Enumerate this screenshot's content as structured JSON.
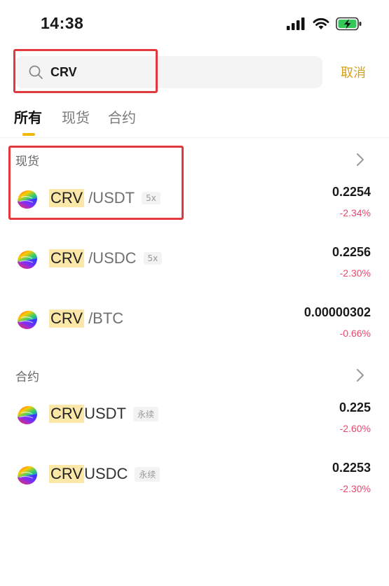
{
  "status_bar": {
    "time": "14:38"
  },
  "search": {
    "value": "CRV",
    "cancel_label": "取消"
  },
  "tabs": [
    {
      "label": "所有",
      "active": true
    },
    {
      "label": "现货",
      "active": false
    },
    {
      "label": "合约",
      "active": false
    }
  ],
  "spot": {
    "title": "现货",
    "rows": [
      {
        "base": "CRV",
        "quote": "/USDT",
        "tag": "5x",
        "price": "0.2254",
        "change": "-2.34%"
      },
      {
        "base": "CRV",
        "quote": "/USDC",
        "tag": "5x",
        "price": "0.2256",
        "change": "-2.30%"
      },
      {
        "base": "CRV",
        "quote": "/BTC",
        "tag": "",
        "price": "0.00000302",
        "change": "-0.66%"
      }
    ]
  },
  "futures": {
    "title": "合约",
    "rows": [
      {
        "base": "CRV",
        "quote": "USDT",
        "tag": "永续",
        "price": "0.225",
        "change": "-2.60%"
      },
      {
        "base": "CRV",
        "quote": "USDC",
        "tag": "永续",
        "price": "0.2253",
        "change": "-2.30%"
      }
    ]
  },
  "colors": {
    "accent": "#f0b90b",
    "cancel": "#d4a017",
    "negative": "#e8476e",
    "highlight": "#fbe7a8",
    "annotation": "#e0393e"
  },
  "icons": [
    "signal-icon",
    "wifi-icon",
    "battery-charging-icon",
    "search-icon",
    "chevron-right-icon",
    "curve-coin-icon"
  ]
}
